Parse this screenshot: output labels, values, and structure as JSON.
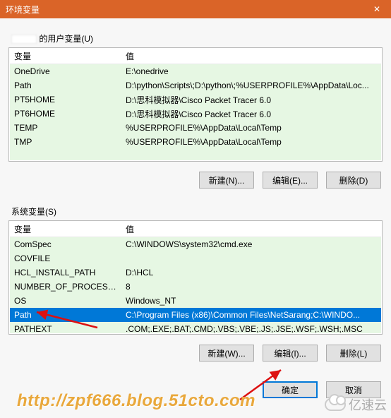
{
  "window": {
    "title": "环境变量",
    "close_icon": "✕"
  },
  "user_section": {
    "label_suffix": " 的用户变量(U)",
    "col_var": "变量",
    "col_val": "值",
    "rows": [
      {
        "var": "OneDrive",
        "val": "E:\\onedrive"
      },
      {
        "var": "Path",
        "val": "D:\\python\\Scripts\\;D:\\python\\;%USERPROFILE%\\AppData\\Loc..."
      },
      {
        "var": "PT5HOME",
        "val": "D:\\思科模拟器\\Cisco Packet Tracer 6.0"
      },
      {
        "var": "PT6HOME",
        "val": "D:\\思科模拟器\\Cisco Packet Tracer 6.0"
      },
      {
        "var": "TEMP",
        "val": "%USERPROFILE%\\AppData\\Local\\Temp"
      },
      {
        "var": "TMP",
        "val": "%USERPROFILE%\\AppData\\Local\\Temp"
      }
    ],
    "buttons": {
      "new": "新建(N)...",
      "edit": "编辑(E)...",
      "del": "删除(D)"
    }
  },
  "system_section": {
    "label": "系统变量(S)",
    "col_var": "变量",
    "col_val": "值",
    "rows": [
      {
        "var": "ComSpec",
        "val": "C:\\WINDOWS\\system32\\cmd.exe"
      },
      {
        "var": "COVFILE",
        "val": ""
      },
      {
        "var": "HCL_INSTALL_PATH",
        "val": "D:\\HCL"
      },
      {
        "var": "NUMBER_OF_PROCESSORS",
        "val": "8"
      },
      {
        "var": "OS",
        "val": "Windows_NT"
      },
      {
        "var": "Path",
        "val": "C:\\Program Files (x86)\\Common Files\\NetSarang;C:\\WINDO...",
        "selected": true
      },
      {
        "var": "PATHEXT",
        "val": ".COM;.EXE;.BAT;.CMD;.VBS;.VBE;.JS;.JSE;.WSF;.WSH;.MSC"
      }
    ],
    "buttons": {
      "new": "新建(W)...",
      "edit": "编辑(I)...",
      "del": "删除(L)"
    }
  },
  "dialog_buttons": {
    "ok": "确定",
    "cancel": "取消"
  },
  "watermark": "http://zpf666.blog.51cto.com",
  "sitelogo": "亿速云"
}
